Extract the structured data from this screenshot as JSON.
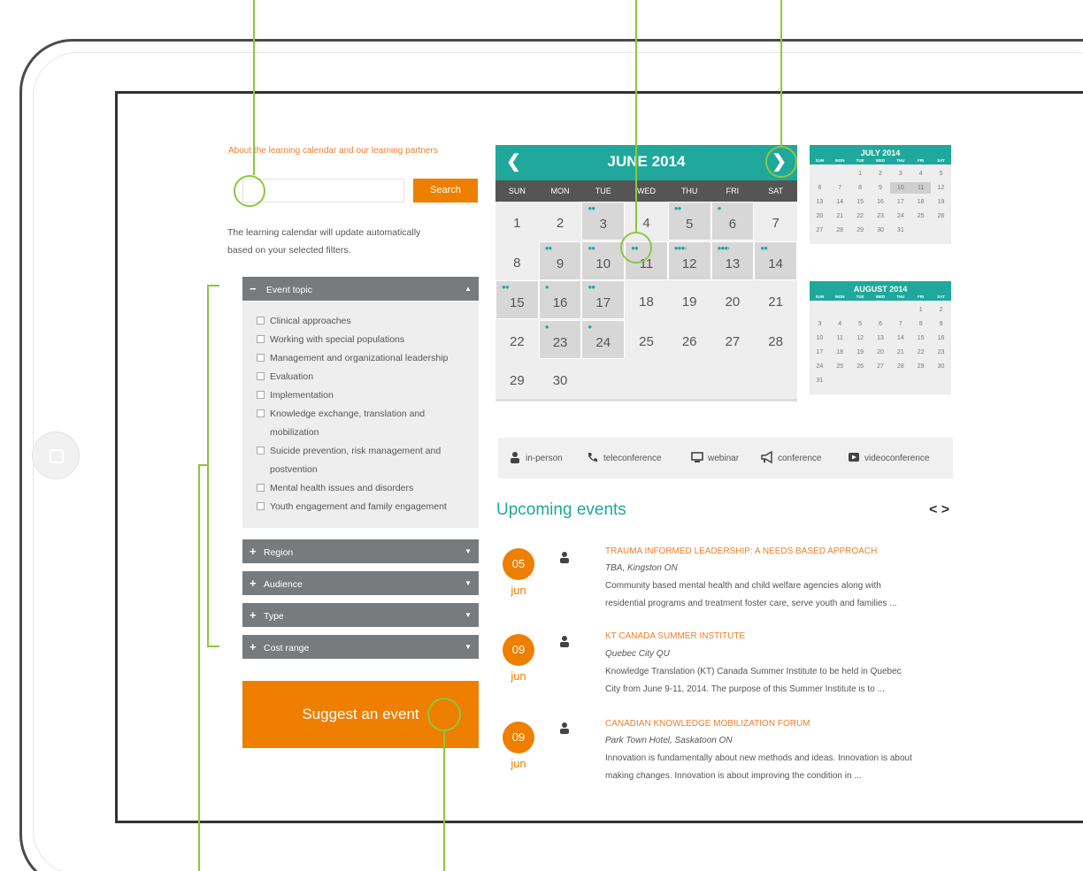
{
  "sidebar": {
    "about_link": "About the learning calendar and our learning partners",
    "search": {
      "placeholder": "",
      "button": "Search"
    },
    "helper_line1": "The learning calendar will update automatically",
    "helper_line2": "based on your selected filters.",
    "event_topic": {
      "label": "Event topic",
      "topics": [
        {
          "line1": "Clinical approaches",
          "line2": ""
        },
        {
          "line1": "Working with special populations",
          "line2": ""
        },
        {
          "line1": "Management and organizational leadership",
          "line2": ""
        },
        {
          "line1": "Evaluation",
          "line2": ""
        },
        {
          "line1": "Implementation",
          "line2": ""
        },
        {
          "line1": "Knowledge exchange, translation and",
          "line2": "mobilization"
        },
        {
          "line1": "Suicide prevention, risk management and",
          "line2": "postvention"
        },
        {
          "line1": "Mental health issues and disorders",
          "line2": ""
        },
        {
          "line1": "Youth engagement and family engagement",
          "line2": ""
        }
      ]
    },
    "filters": [
      "Region",
      "Audience",
      "Type",
      "Cost range"
    ],
    "suggest_button": "Suggest an event"
  },
  "calendar": {
    "title": "JUNE 2014",
    "prev_icon": "chevron-left-icon",
    "next_icon": "chevron-right-icon",
    "days_of_week": [
      "SUN",
      "MON",
      "TUE",
      "WED",
      "THU",
      "FRI",
      "SAT"
    ],
    "weeks": [
      [
        {
          "d": "1",
          "e": 0
        },
        {
          "d": "2",
          "e": 0
        },
        {
          "d": "3",
          "e": 2
        },
        {
          "d": "4",
          "e": 0
        },
        {
          "d": "5",
          "e": 2
        },
        {
          "d": "6",
          "e": 1
        },
        {
          "d": "7",
          "e": 0
        }
      ],
      [
        {
          "d": "8",
          "e": 0
        },
        {
          "d": "9",
          "e": 2
        },
        {
          "d": "10",
          "e": 2
        },
        {
          "d": "11",
          "e": 2
        },
        {
          "d": "12",
          "e": 4
        },
        {
          "d": "13",
          "e": 4
        },
        {
          "d": "14",
          "e": 2
        }
      ],
      [
        {
          "d": "15",
          "e": 2
        },
        {
          "d": "16",
          "e": 1
        },
        {
          "d": "17",
          "e": 2
        },
        {
          "d": "18",
          "e": 0
        },
        {
          "d": "19",
          "e": 0
        },
        {
          "d": "20",
          "e": 0
        },
        {
          "d": "21",
          "e": 0
        }
      ],
      [
        {
          "d": "22",
          "e": 0
        },
        {
          "d": "23",
          "e": 1
        },
        {
          "d": "24",
          "e": 1
        },
        {
          "d": "25",
          "e": 0
        },
        {
          "d": "26",
          "e": 0
        },
        {
          "d": "27",
          "e": 0
        },
        {
          "d": "28",
          "e": 0
        }
      ],
      [
        {
          "d": "29",
          "e": 0
        },
        {
          "d": "30",
          "e": 0
        }
      ]
    ]
  },
  "mini_calendars": [
    {
      "title": "JULY 2014",
      "days_of_week": [
        "SUN",
        "MON",
        "TUE",
        "WED",
        "THU",
        "FRI",
        "SAT"
      ],
      "weeks": [
        [
          "",
          "",
          "1",
          "2",
          "3",
          "4",
          "5"
        ],
        [
          "6",
          "7",
          "8",
          "9",
          "10",
          "11",
          "12"
        ],
        [
          "13",
          "14",
          "15",
          "16",
          "17",
          "18",
          "19"
        ],
        [
          "20",
          "21",
          "22",
          "23",
          "24",
          "25",
          "26"
        ],
        [
          "27",
          "28",
          "29",
          "30",
          "31"
        ]
      ],
      "event_days": [
        "10",
        "11"
      ]
    },
    {
      "title": "AUGUST 2014",
      "days_of_week": [
        "SUN",
        "MON",
        "TUE",
        "WED",
        "THU",
        "FRI",
        "SAT"
      ],
      "weeks": [
        [
          "",
          "",
          "",
          "",
          "",
          "1",
          "2"
        ],
        [
          "3",
          "4",
          "5",
          "6",
          "7",
          "8",
          "9"
        ],
        [
          "10",
          "11",
          "12",
          "13",
          "14",
          "15",
          "16"
        ],
        [
          "17",
          "18",
          "19",
          "20",
          "21",
          "22",
          "23"
        ],
        [
          "24",
          "25",
          "26",
          "27",
          "28",
          "29",
          "30"
        ],
        [
          "31"
        ]
      ],
      "event_days": []
    }
  ],
  "legend": [
    {
      "icon": "person-icon",
      "label": "in-person"
    },
    {
      "icon": "phone-icon",
      "label": "teleconference"
    },
    {
      "icon": "monitor-icon",
      "label": "webinar"
    },
    {
      "icon": "megaphone-icon",
      "label": "conference"
    },
    {
      "icon": "video-icon",
      "label": "videoconference"
    }
  ],
  "upcoming": {
    "title": "Upcoming events",
    "nav_prev": "<",
    "nav_next": ">",
    "events": [
      {
        "day": "05",
        "month": "jun",
        "icon": "person-icon",
        "title": "TRAUMA INFORMED LEADERSHIP: A NEEDS BASED APPROACH",
        "location": "TBA, Kingston ON",
        "desc1": "Community based mental health and child welfare agencies along with",
        "desc2": "residential programs and treatment foster care, serve youth and families ..."
      },
      {
        "day": "09",
        "month": "jun",
        "icon": "person-icon",
        "title": "KT CANADA SUMMER INSTITUTE",
        "location": "Quebec City QU",
        "desc1": "Knowledge Translation (KT) Canada Summer Institute to be held in Quebec",
        "desc2": "City from June 9-11, 2014.  The purpose of this Summer Institute is to ..."
      },
      {
        "day": "09",
        "month": "jun",
        "icon": "person-icon",
        "title": "CANADIAN KNOWLEDGE MOBILIZATION FORUM",
        "location": "Park Town Hotel, Saskatoon ON",
        "desc1": "Innovation is fundamentally about new methods and ideas. Innovation is about",
        "desc2": "making changes. Innovation is about improving the condition in ..."
      }
    ]
  },
  "colors": {
    "accent_teal": "#1fa89b",
    "accent_orange": "#ee7f00",
    "annotation_green": "#8dc63f"
  }
}
